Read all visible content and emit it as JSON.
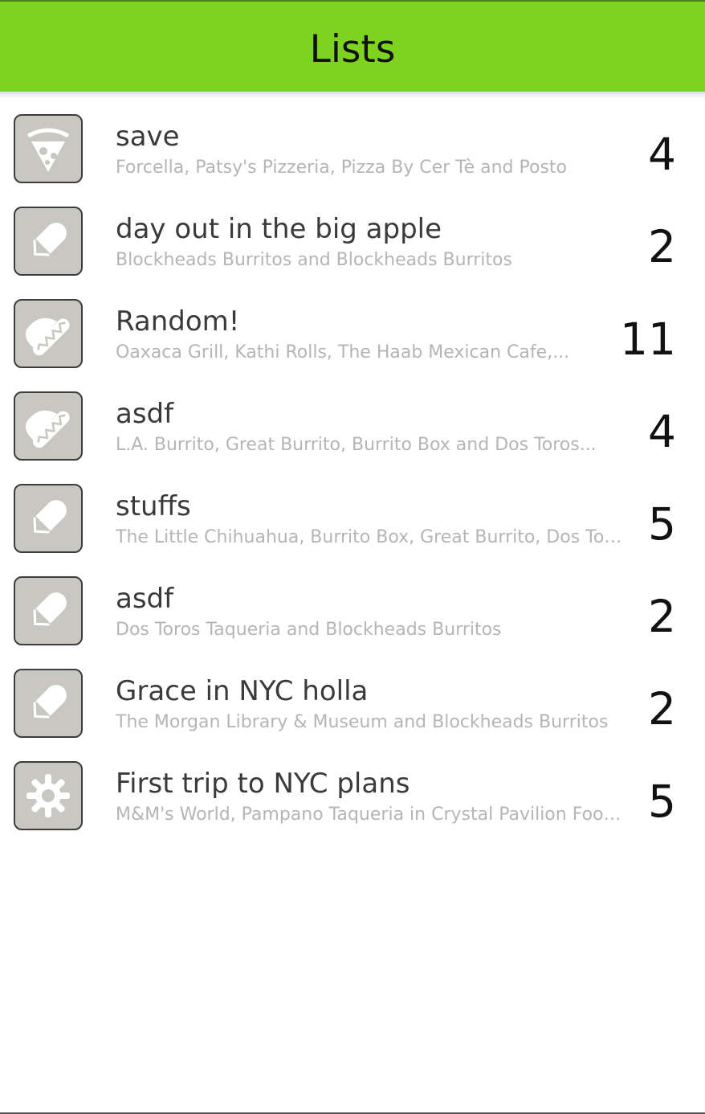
{
  "header": {
    "title": "Lists"
  },
  "colors": {
    "header_bg": "#7ed321",
    "tile_bg": "#c8c7c1",
    "subtitle": "#b5b5b5"
  },
  "lists": [
    {
      "name": "save",
      "items": "Forcella, Patsy's Pizzeria, Pizza By Cer Tè and Posto",
      "count": "4",
      "icon": "pizza-icon"
    },
    {
      "name": "day out in the big apple",
      "items": "Blockheads Burritos and Blockheads Burritos",
      "count": "2",
      "icon": "burrito-icon"
    },
    {
      "name": "Random!",
      "items": "Oaxaca Grill, Kathi Rolls, The Haab Mexican Cafe,...",
      "count": "11",
      "icon": "taco-icon"
    },
    {
      "name": "asdf",
      "items": "L.A. Burrito, Great Burrito, Burrito Box and Dos Toros...",
      "count": "4",
      "icon": "taco-icon"
    },
    {
      "name": "stuffs",
      "items": "The Little Chihuahua, Burrito Box, Great Burrito, Dos Toros...",
      "count": "5",
      "icon": "burrito-icon"
    },
    {
      "name": "asdf",
      "items": "Dos Toros Taqueria and Blockheads Burritos",
      "count": "2",
      "icon": "burrito-icon"
    },
    {
      "name": "Grace in NYC holla",
      "items": "The Morgan Library & Museum and Blockheads Burritos",
      "count": "2",
      "icon": "burrito-icon"
    },
    {
      "name": "First trip to NYC plans",
      "items": "M&M's World, Pampano Taqueria in Crystal Pavilion Food...",
      "count": "5",
      "icon": "candy-icon"
    }
  ]
}
